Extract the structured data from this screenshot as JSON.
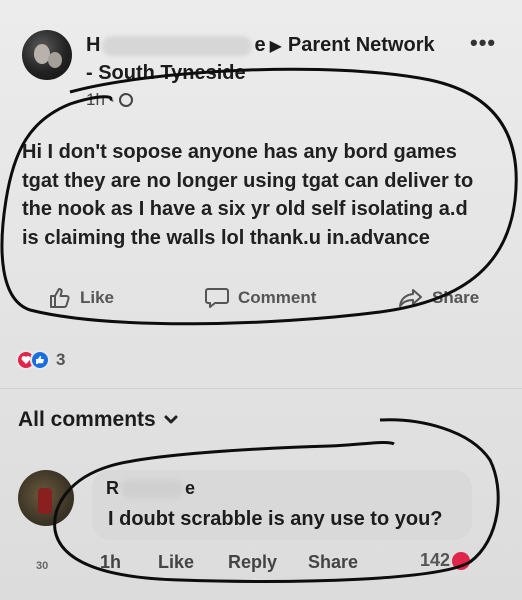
{
  "post": {
    "author_visible_start": "H",
    "author_visible_end": "e",
    "group": "Parent Network",
    "location": "- South Tyneside",
    "time": "1h ·",
    "more": "•••",
    "lines": [
      "Hi I don't sopose anyone has any bord games",
      "tgat they are no longer using tgat can deliver to",
      "the nook as I have a six yr old self isolating a.d",
      "is claiming the walls lol  thank.u in.advance"
    ]
  },
  "actions": {
    "like": "Like",
    "comment": "Comment",
    "share": "Share"
  },
  "reactions": {
    "count": "3",
    "types": [
      "love",
      "like"
    ],
    "colors": {
      "love": "#e0244a",
      "like": "#1a6fe0"
    }
  },
  "comments_header": {
    "label": "All comments",
    "chevron": "⌄"
  },
  "comment": {
    "author_visible_start": "R",
    "author_visible_end": "e",
    "text": "I doubt scrabble is any use to you?",
    "time": "1h",
    "like": "Like",
    "reply": "Reply",
    "share": "Share",
    "reaction_count": "142",
    "side_number": "30"
  }
}
